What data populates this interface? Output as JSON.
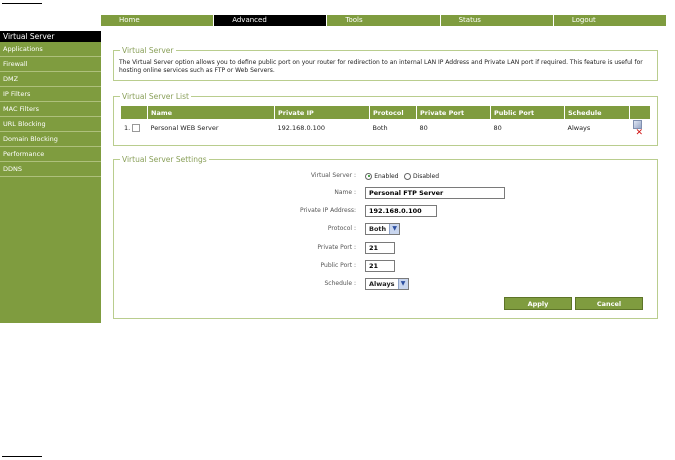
{
  "nav": {
    "tabs": [
      "Home",
      "Advanced",
      "Tools",
      "Status",
      "Logout"
    ],
    "active": 1
  },
  "sidebar": {
    "header": "Virtual Server",
    "items": [
      "Applications",
      "Firewall",
      "DMZ",
      "IP Filters",
      "MAC Filters",
      "URL Blocking",
      "Domain Blocking",
      "Performance",
      "DDNS"
    ]
  },
  "virtual_server": {
    "legend": "Virtual Server",
    "description": "The Virtual Server option allows you to define public port on your router for redirection to an internal LAN IP Address and Private LAN port if required. This feature is useful for hosting online services such as FTP or Web Servers."
  },
  "list": {
    "legend": "Virtual Server List",
    "headers": [
      "",
      "Name",
      "Private IP",
      "Protocol",
      "Private Port",
      "Public Port",
      "Schedule",
      ""
    ],
    "rows": [
      {
        "index": "1.",
        "name": "Personal WEB Server",
        "private_ip": "192.168.0.100",
        "protocol": "Both",
        "private_port": "80",
        "public_port": "80",
        "schedule": "Always"
      }
    ]
  },
  "settings": {
    "legend": "Virtual Server Settings",
    "virtual_server_label": "Virtual Server :",
    "enabled_label": "Enabled",
    "disabled_label": "Disabled",
    "enabled": true,
    "name_label": "Name :",
    "name_value": "Personal FTP Server",
    "ip_label": "Private IP Address:",
    "ip_value": "192.168.0.100",
    "protocol_label": "Protocol :",
    "protocol_value": "Both",
    "private_port_label": "Private Port :",
    "private_port_value": "21",
    "public_port_label": "Public Port :",
    "public_port_value": "21",
    "schedule_label": "Schedule :",
    "schedule_value": "Always",
    "apply_label": "Apply",
    "cancel_label": "Cancel"
  },
  "colors": {
    "accent": "#7f9c3f",
    "border": "#b9cd8e",
    "legend": "#8aa05a"
  }
}
